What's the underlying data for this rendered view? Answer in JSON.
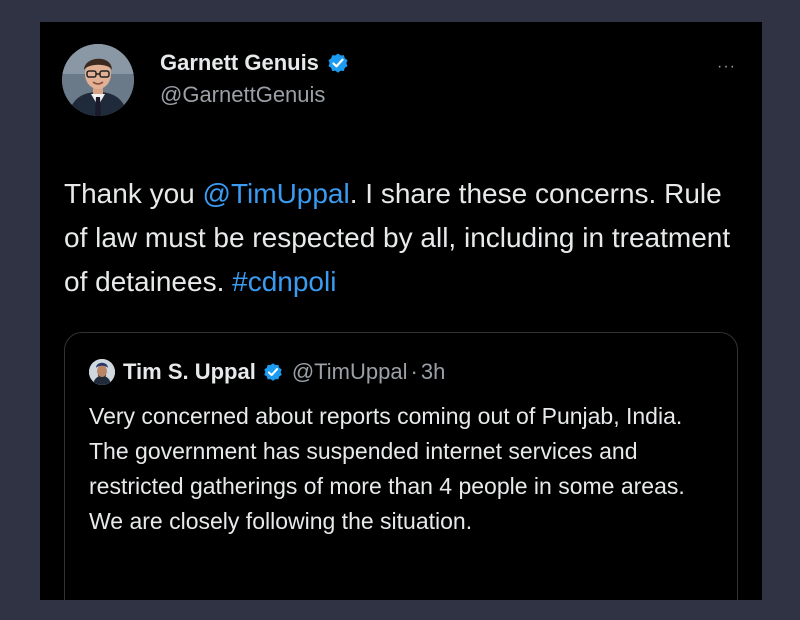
{
  "author": {
    "name": "Garnett Genuis",
    "handle": "@GarnettGenuis",
    "verified": true
  },
  "more_menu": {
    "label": "···"
  },
  "tweet": {
    "text_before": "Thank you ",
    "mention": "@TimUppal",
    "text_middle": ". I share these concerns. Rule of law must be respected by all, including in treatment of detainees. ",
    "hashtag": "#cdnpoli"
  },
  "quoted_tweet": {
    "author_name": "Tim S. Uppal",
    "handle": "@TimUppal",
    "separator": "·",
    "time": "3h",
    "verified": true,
    "text": "Very concerned about reports coming out of Punjab, India. The government has suspended internet services and restricted gatherings of more than 4 people in some areas. We are closely following the situation."
  },
  "colors": {
    "background": "#2f3344",
    "card": "#000000",
    "text": "#e7e9ea",
    "muted": "#9aa0a6",
    "link": "#3a9bf0",
    "verified": "#1d9bf0"
  }
}
